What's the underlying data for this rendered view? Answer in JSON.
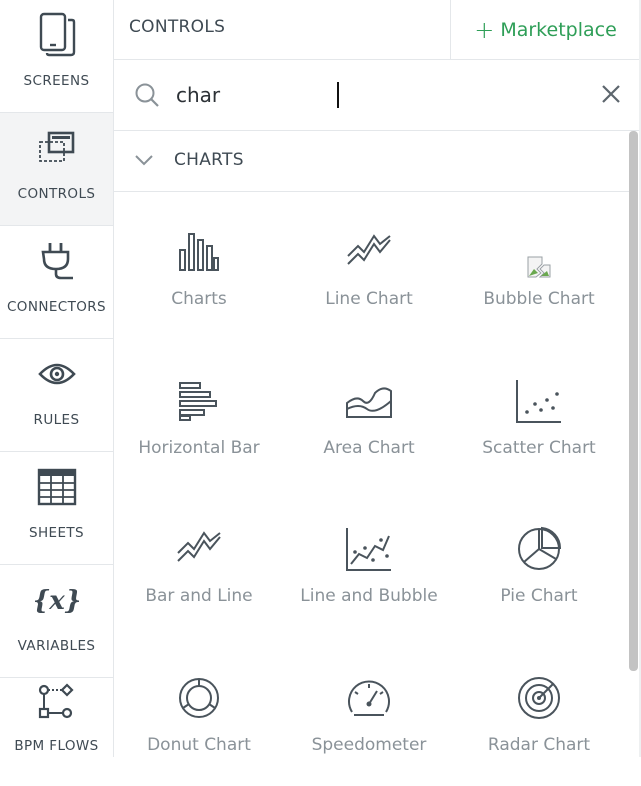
{
  "nav": {
    "items": [
      {
        "label": "SCREENS",
        "icon": "tablet-icon"
      },
      {
        "label": "CONTROLS",
        "icon": "controls-icon",
        "active": true
      },
      {
        "label": "CONNECTORS",
        "icon": "plug-icon"
      },
      {
        "label": "RULES",
        "icon": "eye-icon"
      },
      {
        "label": "SHEETS",
        "icon": "spreadsheet-icon"
      },
      {
        "label": "VARIABLES",
        "icon": "variable-icon"
      },
      {
        "label": "BPM FLOWS",
        "icon": "flow-icon"
      }
    ]
  },
  "header": {
    "title": "CONTROLS",
    "marketplace_plus": "+",
    "marketplace_label": "Marketplace"
  },
  "search": {
    "value": "char",
    "placeholder": ""
  },
  "section": {
    "title": "CHARTS"
  },
  "controls": [
    {
      "label": "Charts",
      "icon": "bar-chart-icon"
    },
    {
      "label": "Line Chart",
      "icon": "line-chart-icon"
    },
    {
      "label": "Bubble Chart",
      "icon": "broken-image-icon"
    },
    {
      "label": "Horizontal Bar",
      "icon": "horizontal-bar-icon"
    },
    {
      "label": "Area Chart",
      "icon": "area-chart-icon"
    },
    {
      "label": "Scatter Chart",
      "icon": "scatter-chart-icon"
    },
    {
      "label": "Bar and Line",
      "icon": "bar-line-icon"
    },
    {
      "label": "Line and Bubble",
      "icon": "line-bubble-icon"
    },
    {
      "label": "Pie Chart",
      "icon": "pie-chart-icon"
    },
    {
      "label": "Donut Chart",
      "icon": "donut-chart-icon"
    },
    {
      "label": "Speedometer",
      "icon": "speedometer-icon"
    },
    {
      "label": "Radar Chart",
      "icon": "radar-chart-icon"
    }
  ],
  "colors": {
    "accent": "#2e9e57",
    "text": "#3f4a53",
    "muted_label": "#8a9298",
    "active_nav_bg": "#f3f4f5",
    "border": "#e4e7ea"
  }
}
